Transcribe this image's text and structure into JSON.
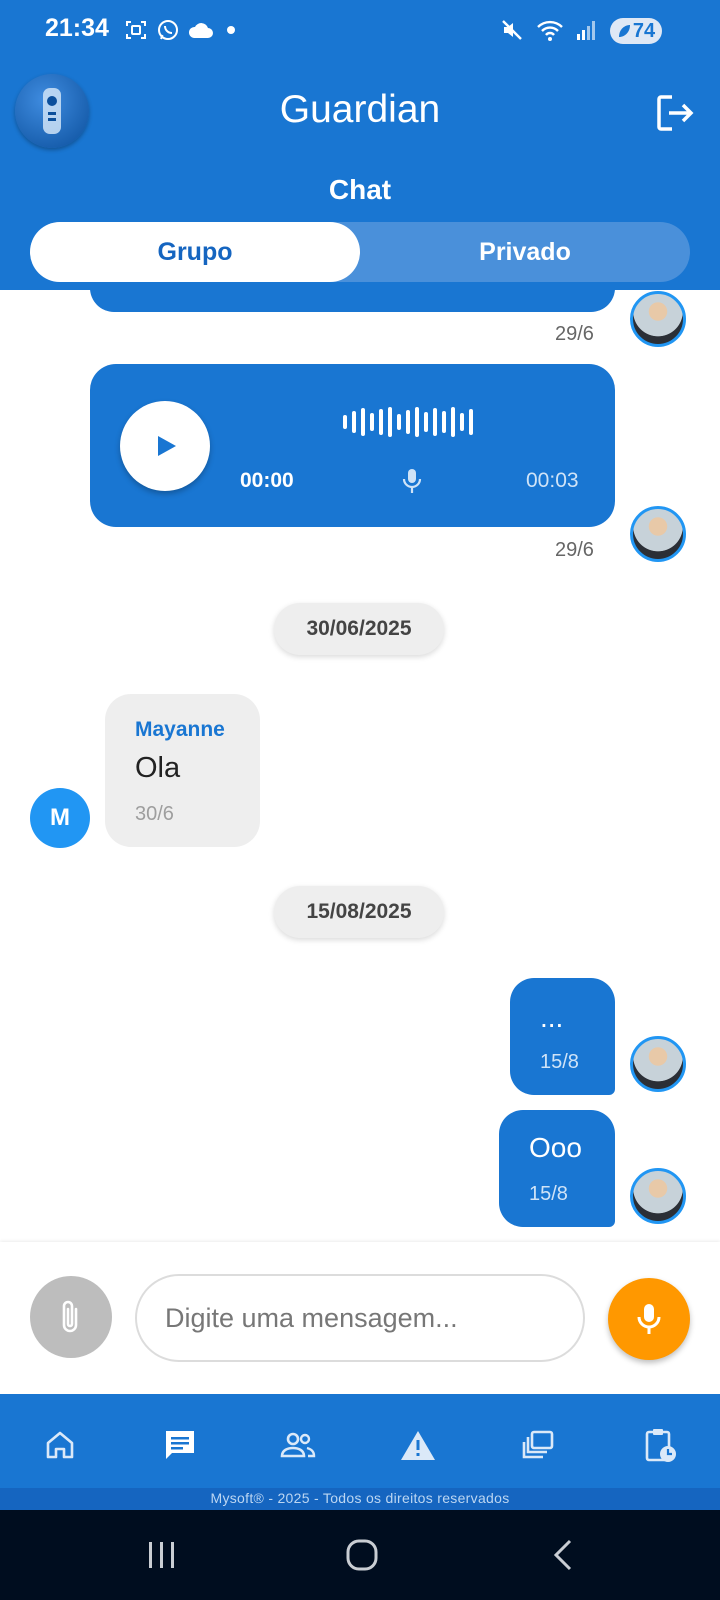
{
  "status_bar": {
    "time": "21:34",
    "battery": "74",
    "left_icons": [
      "screenshot-icon",
      "whatsapp-icon",
      "cloud-icon",
      "dot-icon"
    ],
    "right_icons": [
      "mute-icon",
      "wifi-icon",
      "signal-icon"
    ]
  },
  "header": {
    "title": "Guardian",
    "section": "Chat",
    "tabs": [
      {
        "label": "Grupo",
        "active": true
      },
      {
        "label": "Privado",
        "active": false
      }
    ]
  },
  "messages": [
    {
      "type": "text-out",
      "time": "29/6"
    },
    {
      "type": "audio-out",
      "current": "00:00",
      "duration": "00:03",
      "time": "29/6"
    },
    {
      "type": "date",
      "label": "30/06/2025"
    },
    {
      "type": "text-in",
      "sender": "Mayanne",
      "initial": "M",
      "text": "Ola",
      "time": "30/6"
    },
    {
      "type": "date",
      "label": "15/08/2025"
    },
    {
      "type": "text-out",
      "text": "...",
      "time": "15/8"
    },
    {
      "type": "text-out",
      "text": "Ooo",
      "time": "15/8"
    }
  ],
  "composer": {
    "placeholder": "Digite uma mensagem..."
  },
  "bottom_nav": {
    "items": [
      "home-icon",
      "chat-icon",
      "people-icon",
      "warning-icon",
      "gallery-icon",
      "schedule-icon"
    ],
    "active": "chat-icon"
  },
  "footer": "Mysoft® - 2025 - Todos os direitos reservados",
  "colors": {
    "primary": "#1976d2",
    "accent": "#ff9800",
    "incoming_bubble": "#eeeeee"
  }
}
